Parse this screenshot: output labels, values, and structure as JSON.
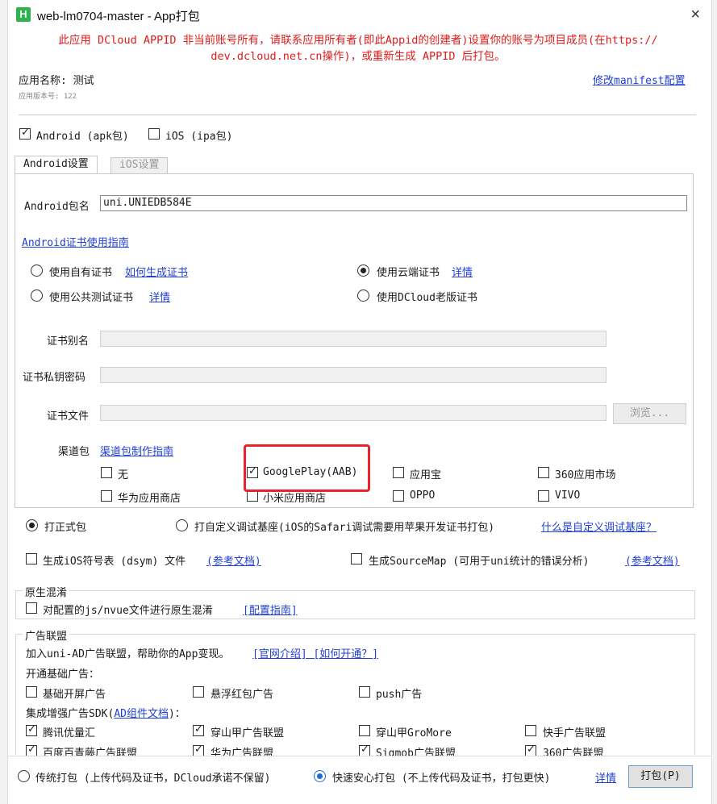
{
  "window": {
    "title": "web-lm0704-master - App打包",
    "app_icon": "H",
    "close_glyph": "×"
  },
  "warning": {
    "line1": "此应用 DCloud APPID 非当前账号所有，请联系应用所有者(即此Appid的创建者)设置你的账号为项目成员(在https://",
    "line2": "dev.dcloud.net.cn操作)，或重新生成 APPID 后打包。"
  },
  "app_info": {
    "name": "应用名称: 测试",
    "version": "应用版本号: 122",
    "modify_manifest_link": "修改manifest配置"
  },
  "platforms": {
    "android": {
      "label": "Android (apk包)",
      "checked": true
    },
    "ios": {
      "label": "iOS (ipa包)",
      "checked": false
    }
  },
  "tabs": {
    "android": "Android设置",
    "ios": "iOS设置"
  },
  "android": {
    "package_label": "Android包名",
    "package_value": "uni.UNIEDB584E",
    "cert_guide_link": "Android证书使用指南",
    "cert_options": {
      "own": {
        "label": "使用自有证书",
        "link": "如何生成证书",
        "selected": false
      },
      "cloud": {
        "label": "使用云端证书",
        "link": "详情",
        "selected": true
      },
      "public_test": {
        "label": "使用公共测试证书",
        "link": "详情",
        "selected": false
      },
      "dcloud_old": {
        "label": "使用DCloud老版证书",
        "selected": false
      }
    },
    "alias_label": "证书别名",
    "password_label": "证书私钥密码",
    "file_label": "证书文件",
    "browse_button": "浏览...",
    "channel_label": "渠道包",
    "channel_guide_link": "渠道包制作指南",
    "channels": [
      {
        "label": "无",
        "checked": false
      },
      {
        "label": "GooglePlay(AAB)",
        "checked": true
      },
      {
        "label": "应用宝",
        "checked": false
      },
      {
        "label": "360应用市场",
        "checked": false
      },
      {
        "label": "华为应用商店",
        "checked": false
      },
      {
        "label": "小米应用商店",
        "checked": false
      },
      {
        "label": "OPPO",
        "checked": false
      },
      {
        "label": "VIVO",
        "checked": false
      }
    ]
  },
  "build_type": {
    "release": {
      "label": "打正式包",
      "selected": true
    },
    "custom_base": {
      "label": "打自定义调试基座(iOS的Safari调试需要用苹果开发证书打包)",
      "selected": false
    },
    "custom_base_link": "什么是自定义调试基座？"
  },
  "symbols": {
    "ios_dsym": {
      "label": "生成iOS符号表 (dsym) 文件",
      "link": "(参考文档)",
      "checked": false
    },
    "sourcemap": {
      "label": "生成SourceMap (可用于uni统计的错误分析)",
      "link": "(参考文档)",
      "checked": false
    }
  },
  "obfuscation": {
    "title": "原生混淆",
    "label": "对配置的js/nvue文件进行原生混淆",
    "link": "[配置指南]",
    "checked": false
  },
  "ads": {
    "title": "广告联盟",
    "intro": "加入uni-AD广告联盟，帮助你的App变现。",
    "intro_link": "[官网介绍] [如何开通？]",
    "basic_title": "开通基础广告：",
    "basic": [
      {
        "label": "基础开屏广告",
        "checked": false
      },
      {
        "label": "悬浮红包广告",
        "checked": false
      },
      {
        "label": "push广告",
        "checked": false
      }
    ],
    "sdk_title_pre": "集成增强广告SDK(",
    "sdk_title_link": "AD组件文档",
    "sdk_title_post": ")：",
    "sdk": [
      {
        "label": "腾讯优量汇",
        "checked": true
      },
      {
        "label": "穿山甲广告联盟",
        "checked": true
      },
      {
        "label": "穿山甲GroMore",
        "checked": false
      },
      {
        "label": "快手广告联盟",
        "checked": false
      },
      {
        "label": "百度百青藤广告联盟",
        "checked": true
      },
      {
        "label": "华为广告联盟",
        "checked": true
      },
      {
        "label": "Sigmob广告联盟",
        "checked": true
      },
      {
        "label": "360广告联盟",
        "checked": true
      }
    ]
  },
  "footer": {
    "traditional": {
      "label": "传统打包 (上传代码及证书，DCloud承诺不保留)",
      "selected": false
    },
    "fast_safe": {
      "label": "快速安心打包 (不上传代码及证书，打包更快)",
      "selected": true
    },
    "details_link": "详情",
    "build_button": "打包(P)"
  }
}
